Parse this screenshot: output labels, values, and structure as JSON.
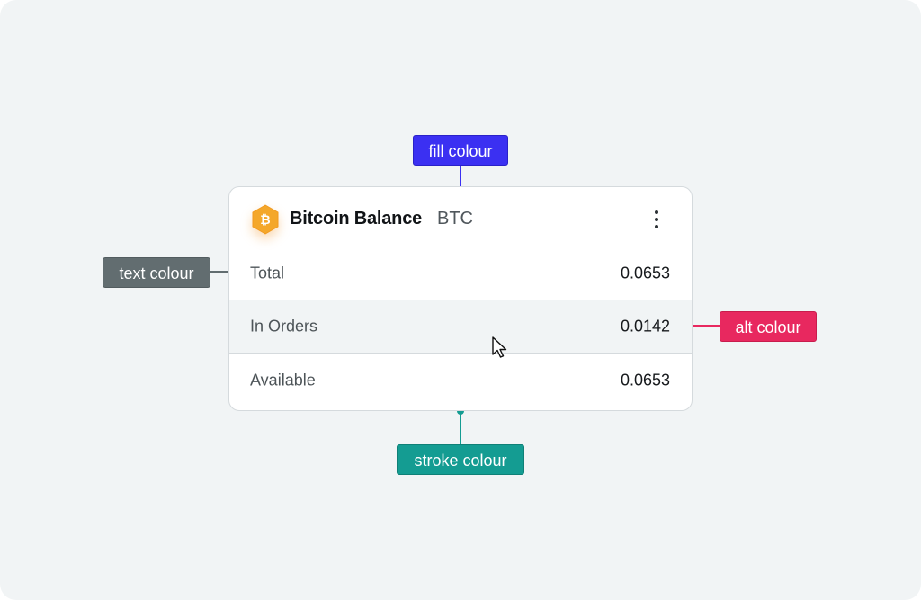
{
  "card": {
    "title": "Bitcoin Balance",
    "ticker": "BTC",
    "icon": "bitcoin-coin-icon",
    "menu_icon": "vertical-dots-icon",
    "rows": [
      {
        "label": "Total",
        "value": "0.0653"
      },
      {
        "label": "In Orders",
        "value": "0.0142"
      },
      {
        "label": "Available",
        "value": "0.0653"
      }
    ]
  },
  "annotations": {
    "fill": {
      "label": "fill colour",
      "color": "#3b30f2"
    },
    "text": {
      "label": "text colour",
      "color": "#626d70"
    },
    "alt": {
      "label": "alt colour",
      "color": "#e8285f"
    },
    "stroke": {
      "label": "stroke colour",
      "color": "#149c92"
    }
  },
  "colors": {
    "background": "#f1f4f5",
    "card_fill": "#ffffff",
    "card_stroke": "#d5dadd",
    "alt_row": "#f1f4f5",
    "coin": "#f4a72a"
  }
}
